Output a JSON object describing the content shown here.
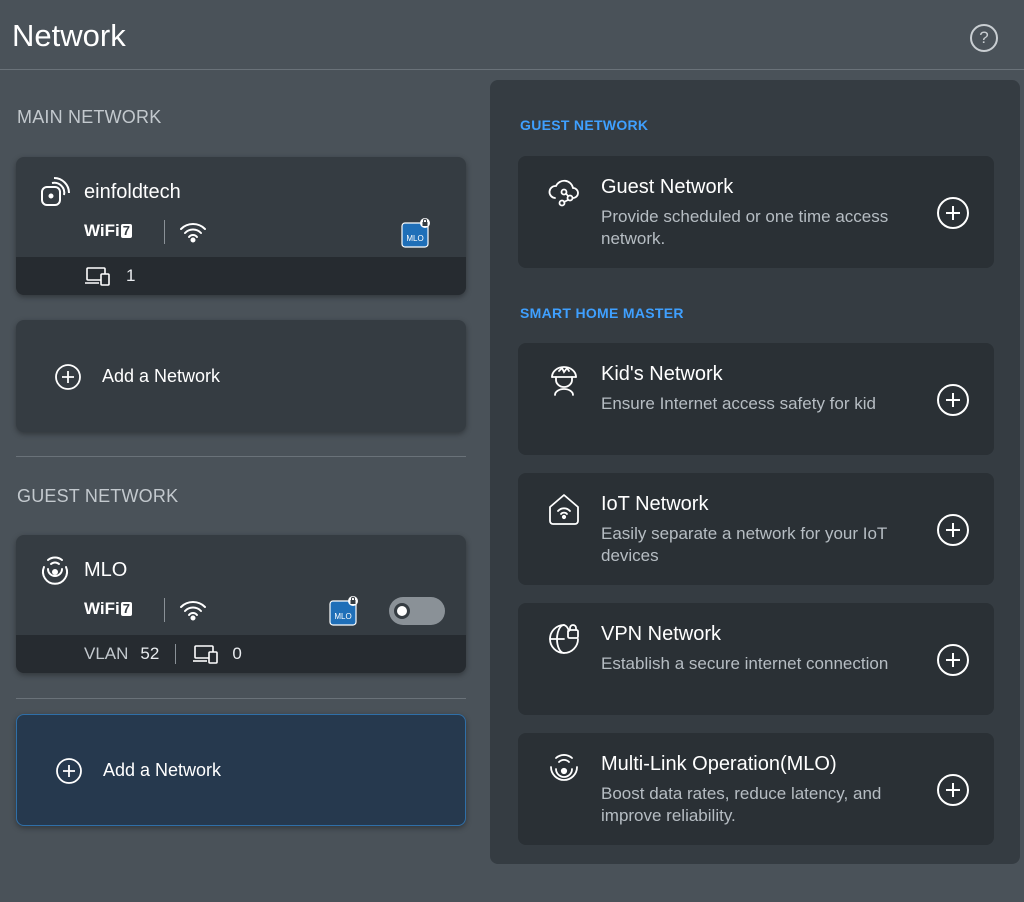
{
  "header": {
    "title": "Network",
    "help_glyph": "?"
  },
  "main_section": {
    "label": "MAIN NETWORK",
    "network": {
      "name": "einfoldtech",
      "icon": "router-signal-icon",
      "wifi_label": "WiFi",
      "wifi_gen": "7",
      "mlo_badge": "MLO",
      "device_count": "1"
    },
    "add_label": "Add a Network"
  },
  "guest_section": {
    "label": "GUEST NETWORK",
    "network": {
      "name": "MLO",
      "icon": "mlo-signal-icon",
      "wifi_label": "WiFi",
      "wifi_gen": "7",
      "mlo_badge": "MLO",
      "vlan_label": "VLAN",
      "vlan_id": "52",
      "device_count": "0",
      "enabled": false
    },
    "add_label": "Add a Network"
  },
  "right_panel": {
    "guest_label": "GUEST NETWORK",
    "smart_label": "SMART HOME MASTER",
    "guest_card": {
      "title": "Guest Network",
      "desc": "Provide scheduled or one time access network.",
      "icon": "cloud-network-icon"
    },
    "smart_cards": [
      {
        "title": "Kid's Network",
        "desc": "Ensure Internet access safety for kid",
        "icon": "kid-icon"
      },
      {
        "title": "IoT Network",
        "desc": "Easily separate a network for your IoT devices",
        "icon": "home-wifi-icon"
      },
      {
        "title": "VPN Network",
        "desc": "Establish a secure internet connection",
        "icon": "globe-lock-icon"
      },
      {
        "title": "Multi-Link Operation(MLO)",
        "desc": "Boost data rates, reduce latency, and improve reliability.",
        "icon": "mlo-icon"
      }
    ]
  },
  "colors": {
    "background": "#4a5259",
    "card": "#353c42",
    "card_footer": "#262b30",
    "accent_blue": "#3fa0ff",
    "active_card": "#26394e",
    "mlo_badge": "#1f6fb8"
  }
}
